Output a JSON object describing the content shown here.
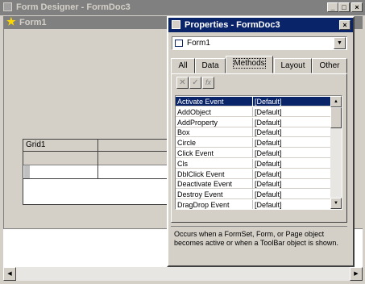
{
  "designer": {
    "title": "Form Designer - FormDoc3",
    "form_title": "Form1",
    "grid_caption": "Grid1"
  },
  "properties": {
    "title": "Properties - FormDoc3",
    "object_select": "Form1",
    "tabs": [
      {
        "label": "All",
        "active": false
      },
      {
        "label": "Data",
        "active": false
      },
      {
        "label": "Methods",
        "active": true
      },
      {
        "label": "Layout",
        "active": false
      },
      {
        "label": "Other",
        "active": false
      }
    ],
    "rows": [
      {
        "name": "Activate Event",
        "value": "[Default]",
        "selected": true
      },
      {
        "name": "AddObject",
        "value": "[Default]",
        "selected": false
      },
      {
        "name": "AddProperty",
        "value": "[Default]",
        "selected": false
      },
      {
        "name": "Box",
        "value": "[Default]",
        "selected": false
      },
      {
        "name": "Circle",
        "value": "[Default]",
        "selected": false
      },
      {
        "name": "Click Event",
        "value": "[Default]",
        "selected": false
      },
      {
        "name": "Cls",
        "value": "[Default]",
        "selected": false
      },
      {
        "name": "DblClick Event",
        "value": "[Default]",
        "selected": false
      },
      {
        "name": "Deactivate Event",
        "value": "[Default]",
        "selected": false
      },
      {
        "name": "Destroy Event",
        "value": "[Default]",
        "selected": false
      },
      {
        "name": "DragDrop Event",
        "value": "[Default]",
        "selected": false
      }
    ],
    "description": "Occurs when a FormSet, Form, or Page object becomes active or when a ToolBar object is shown."
  },
  "window_buttons": {
    "minimize": "_",
    "maximize": "□",
    "close": "×"
  },
  "icons": [
    "minimize-icon",
    "maximize-icon",
    "close-icon",
    "form-icon",
    "dropdown-arrow-icon",
    "cancel-icon",
    "accept-icon",
    "function-icon",
    "scroll-up-icon",
    "scroll-down-icon",
    "scroll-left-icon",
    "scroll-right-icon"
  ]
}
